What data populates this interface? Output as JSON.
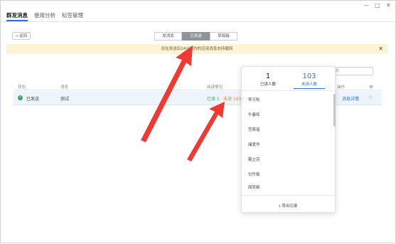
{
  "nav": {
    "tabs": [
      {
        "label": "群发消息"
      },
      {
        "label": "使用分析"
      },
      {
        "label": "标签管理"
      }
    ],
    "window_controls": [
      "—",
      "□",
      "✕"
    ]
  },
  "toolbar": {
    "back_label": "« 返回",
    "segments": [
      {
        "label": "发消息"
      },
      {
        "label": "已发送"
      },
      {
        "label": "草稿箱"
      }
    ]
  },
  "notice": {
    "text": "仅在发送后24小时内的应用消息支持撤回"
  },
  "search": {
    "text": "搜索"
  },
  "table": {
    "headers": [
      "状态",
      "消息",
      "阅读情况",
      "操作"
    ],
    "row": {
      "status": "已发送",
      "message": "测试",
      "read": "已读 1",
      "unread": "未读 103",
      "action": "消息详情"
    }
  },
  "popup": {
    "read_count": "1",
    "read_label": "已读人数",
    "unread_count": "103",
    "unread_label": "未读人数",
    "names": [
      "李万秋",
      "牛春晖",
      "劳燕瑶",
      "储爱华",
      "赖立芬",
      "匀竹筱",
      "闻奕颖"
    ],
    "export_label": "导出记录"
  },
  "colors": {
    "accent": "#2f6fd6",
    "read": "#3aa55d",
    "unread": "#e8842e",
    "arrow": "#ee3a33"
  }
}
